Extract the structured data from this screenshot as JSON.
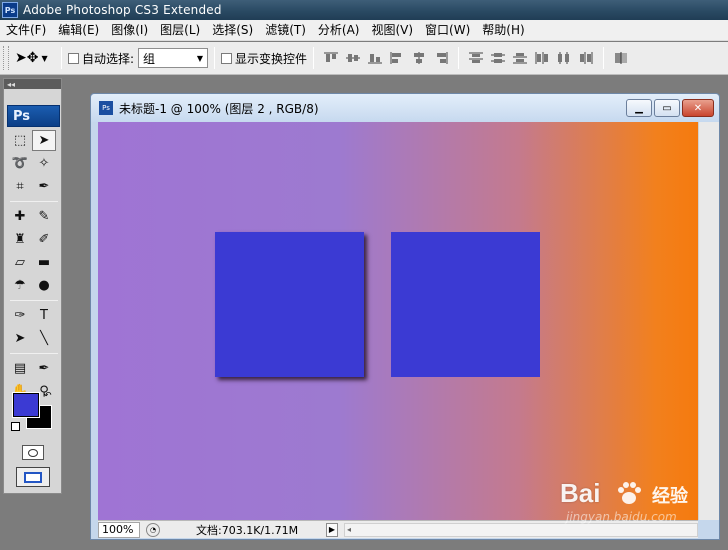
{
  "app": {
    "title": "Adobe Photoshop CS3 Extended",
    "logo": "Ps"
  },
  "menu": [
    "文件(F)",
    "编辑(E)",
    "图像(I)",
    "图层(L)",
    "选择(S)",
    "滤镜(T)",
    "分析(A)",
    "视图(V)",
    "窗口(W)",
    "帮助(H)"
  ],
  "options": {
    "auto_select_label": "自动选择:",
    "auto_select_checked": false,
    "auto_select_target": "组",
    "show_transform_label": "显示变换控件",
    "show_transform_checked": false,
    "align_icons": [
      "align-top-icon",
      "align-vcenter-icon",
      "align-bottom-icon",
      "align-left-icon",
      "align-hcenter-icon",
      "align-right-icon"
    ],
    "distribute_icons": [
      "distribute-top-icon",
      "distribute-vcenter-icon",
      "distribute-bottom-icon",
      "distribute-left-icon",
      "distribute-hcenter-icon",
      "distribute-right-icon"
    ],
    "auto_align_icon": "auto-align-layers-icon"
  },
  "toolbox": {
    "badge": "Ps",
    "foreground_color": "#3b3ad3",
    "background_color": "#000000"
  },
  "document": {
    "title": "未标题-1 @ 100% (图层 2 , RGB/8)",
    "zoom": "100%",
    "doc_info": "文档:703.1K/1.71M",
    "canvas_gradient": [
      "#9f74d4",
      "#f57a0e"
    ],
    "square_color": "#3b3ad3"
  },
  "watermark": {
    "brand": "Bai",
    "brand_suffix": "经验",
    "url": "jingyan.baidu.com"
  }
}
